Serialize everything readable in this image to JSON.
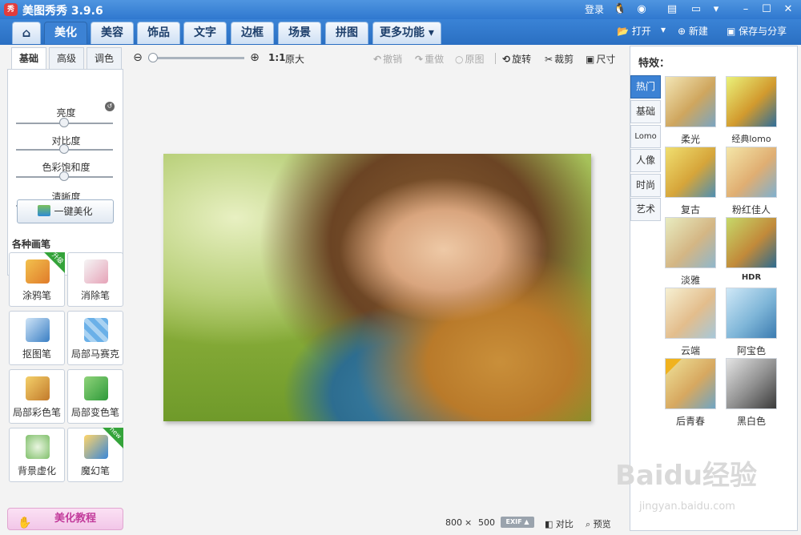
{
  "app": {
    "logo": "秀",
    "title": "美图秀秀 3.9.6",
    "login": "登录"
  },
  "title_icons": [
    "qq-icon",
    "weibo-icon",
    "feedback-icon",
    "message-icon",
    "dropdown-icon",
    "minimize-icon",
    "maximize-icon",
    "close-icon"
  ],
  "tabs": [
    {
      "label": "",
      "icon": "home-icon"
    },
    {
      "label": "美化",
      "active": true
    },
    {
      "label": "美容"
    },
    {
      "label": "饰品"
    },
    {
      "label": "文字"
    },
    {
      "label": "边框"
    },
    {
      "label": "场景"
    },
    {
      "label": "拼图"
    },
    {
      "label": "更多功能"
    }
  ],
  "toolbar_right": {
    "open": "打开",
    "new": "新建",
    "save": "保存与分享"
  },
  "left": {
    "subtabs": [
      "基础",
      "高级",
      "调色"
    ],
    "sliders": [
      {
        "label": "亮度",
        "value": 0.5
      },
      {
        "label": "对比度",
        "value": 0.5
      },
      {
        "label": "色彩饱和度",
        "value": 0.5
      },
      {
        "label": "清晰度",
        "value": 0.5
      }
    ],
    "one_key": "一键美化",
    "brushes_title": "各种画笔",
    "brushes": [
      {
        "label": "涂鸦笔",
        "badge": "升级"
      },
      {
        "label": "消除笔"
      },
      {
        "label": "抠图笔"
      },
      {
        "label": "局部马赛克"
      },
      {
        "label": "局部彩色笔"
      },
      {
        "label": "局部变色笔"
      },
      {
        "label": "背景虚化"
      },
      {
        "label": "魔幻笔",
        "badge": "new"
      }
    ],
    "tutorial": "美化教程"
  },
  "toolbar": {
    "zoom_level": 0.0,
    "ratio_label": "1:1",
    "original_size": "原大",
    "undo": "撤销",
    "redo": "重做",
    "original": "原图",
    "rotate": "旋转",
    "crop": "裁剪",
    "size": "尺寸"
  },
  "status": {
    "width": "800",
    "times": "×",
    "height": "500",
    "exif": "EXIF ▲",
    "compare": "对比",
    "preview": "预览"
  },
  "effects": {
    "title": "特效：",
    "categories": [
      "热门",
      "基础",
      "Lomo",
      "人像",
      "时尚",
      "艺术"
    ],
    "items": [
      {
        "label": "柔光"
      },
      {
        "label": "经典lomo"
      },
      {
        "label": "复古"
      },
      {
        "label": "粉红佳人"
      },
      {
        "label": "淡雅"
      },
      {
        "label": "HDR"
      },
      {
        "label": "云端"
      },
      {
        "label": "阿宝色"
      },
      {
        "label": "后青春",
        "badge": true
      },
      {
        "label": "黑白色"
      }
    ]
  },
  "watermark": {
    "brand": "Baidu经验",
    "url": "jingyan.baidu.com"
  },
  "colors": {
    "accent": "#3c82d4",
    "titlebar": "#2f78cf",
    "badge_green": "#34a33a"
  }
}
